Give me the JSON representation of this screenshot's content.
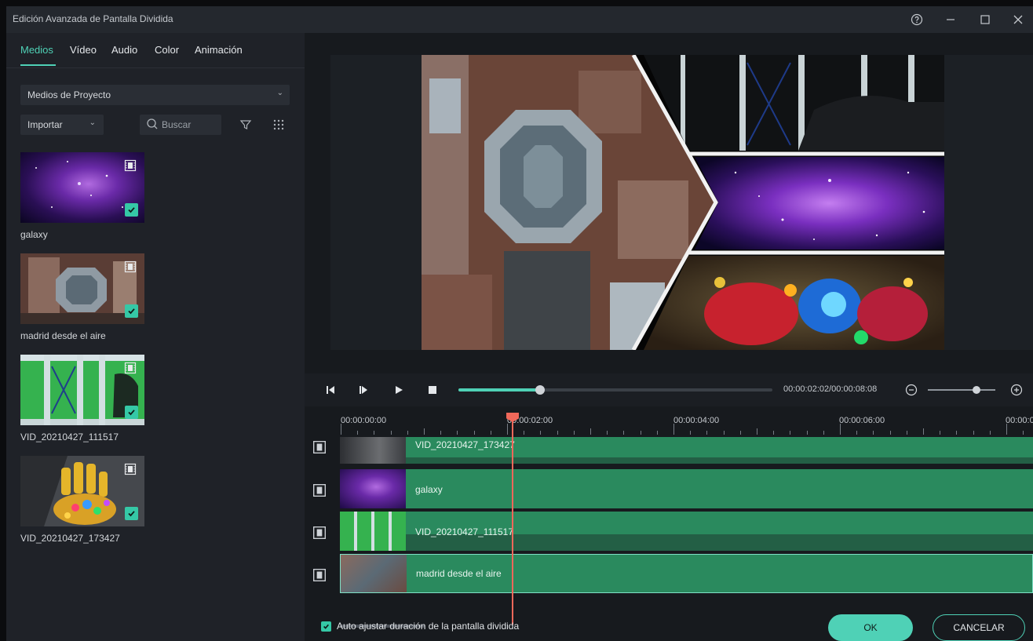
{
  "window": {
    "title": "Edición Avanzada de Pantalla Dividida"
  },
  "tabs": [
    {
      "label": "Medios"
    },
    {
      "label": "Vídeo"
    },
    {
      "label": "Audio"
    },
    {
      "label": "Color"
    },
    {
      "label": "Animación"
    }
  ],
  "media_source": {
    "selected": "Medios de Proyecto"
  },
  "import": {
    "label": "Importar"
  },
  "search": {
    "placeholder": "Buscar"
  },
  "media_items": [
    {
      "name": "galaxy"
    },
    {
      "name": "madrid desde el aire"
    },
    {
      "name": "VID_20210427_111517"
    },
    {
      "name": "VID_20210427_173427"
    }
  ],
  "playback": {
    "timecode": "00:00:02:02/00:00:08:08",
    "progress": 0.26
  },
  "zoom": {
    "level": 0.72
  },
  "ruler": {
    "labels": [
      "00:00:00:00",
      "00:00:02:00",
      "00:00:04:00",
      "00:00:06:00",
      "00:00:0"
    ]
  },
  "tracks": [
    {
      "name": "VID_20210427_173427"
    },
    {
      "name": "galaxy"
    },
    {
      "name": "VID_20210427_111517"
    },
    {
      "name": "madrid desde el aire"
    }
  ],
  "footer": {
    "autofit_label": "Auto ajustar duración de la pantalla dividida",
    "ok_label": "OK",
    "cancel_label": "CANCELAR"
  },
  "colors": {
    "accent": "#4fd1b6",
    "track": "#2a8a5e",
    "playhead": "#f0685a"
  }
}
